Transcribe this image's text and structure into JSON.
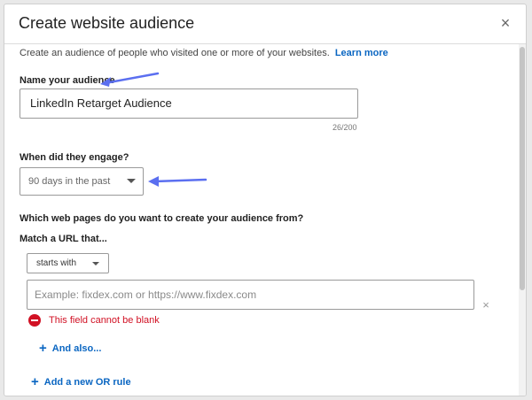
{
  "modal": {
    "title": "Create website audience",
    "close_label": "×",
    "description": "Create an audience of people who visited one or more of your websites.",
    "learn_more": "Learn more"
  },
  "name_section": {
    "label": "Name your audience",
    "value": "LinkedIn Retarget Audience",
    "char_count": "26/200"
  },
  "engage_section": {
    "label": "When did they engage?",
    "selected": "90 days in the past"
  },
  "pages_section": {
    "question": "Which web pages do you want to create your audience from?",
    "match_label": "Match a URL that...",
    "match_type": "starts with",
    "url_placeholder": "Example: fixdex.com or https://www.fixdex.com",
    "url_value": "",
    "error": "This field cannot be blank",
    "clear_label": "×",
    "add_and": "And also...",
    "add_or": "Add a new OR rule"
  },
  "icons": {
    "close": "close-icon",
    "dropdown": "chevron-down-icon",
    "error": "error-icon",
    "plus": "plus-icon",
    "clear": "clear-icon",
    "annotation": "arrow-annotation-icon"
  },
  "colors": {
    "link": "#0a66c2",
    "error": "#d11124",
    "annotation_arrow": "#5b6ff0"
  }
}
